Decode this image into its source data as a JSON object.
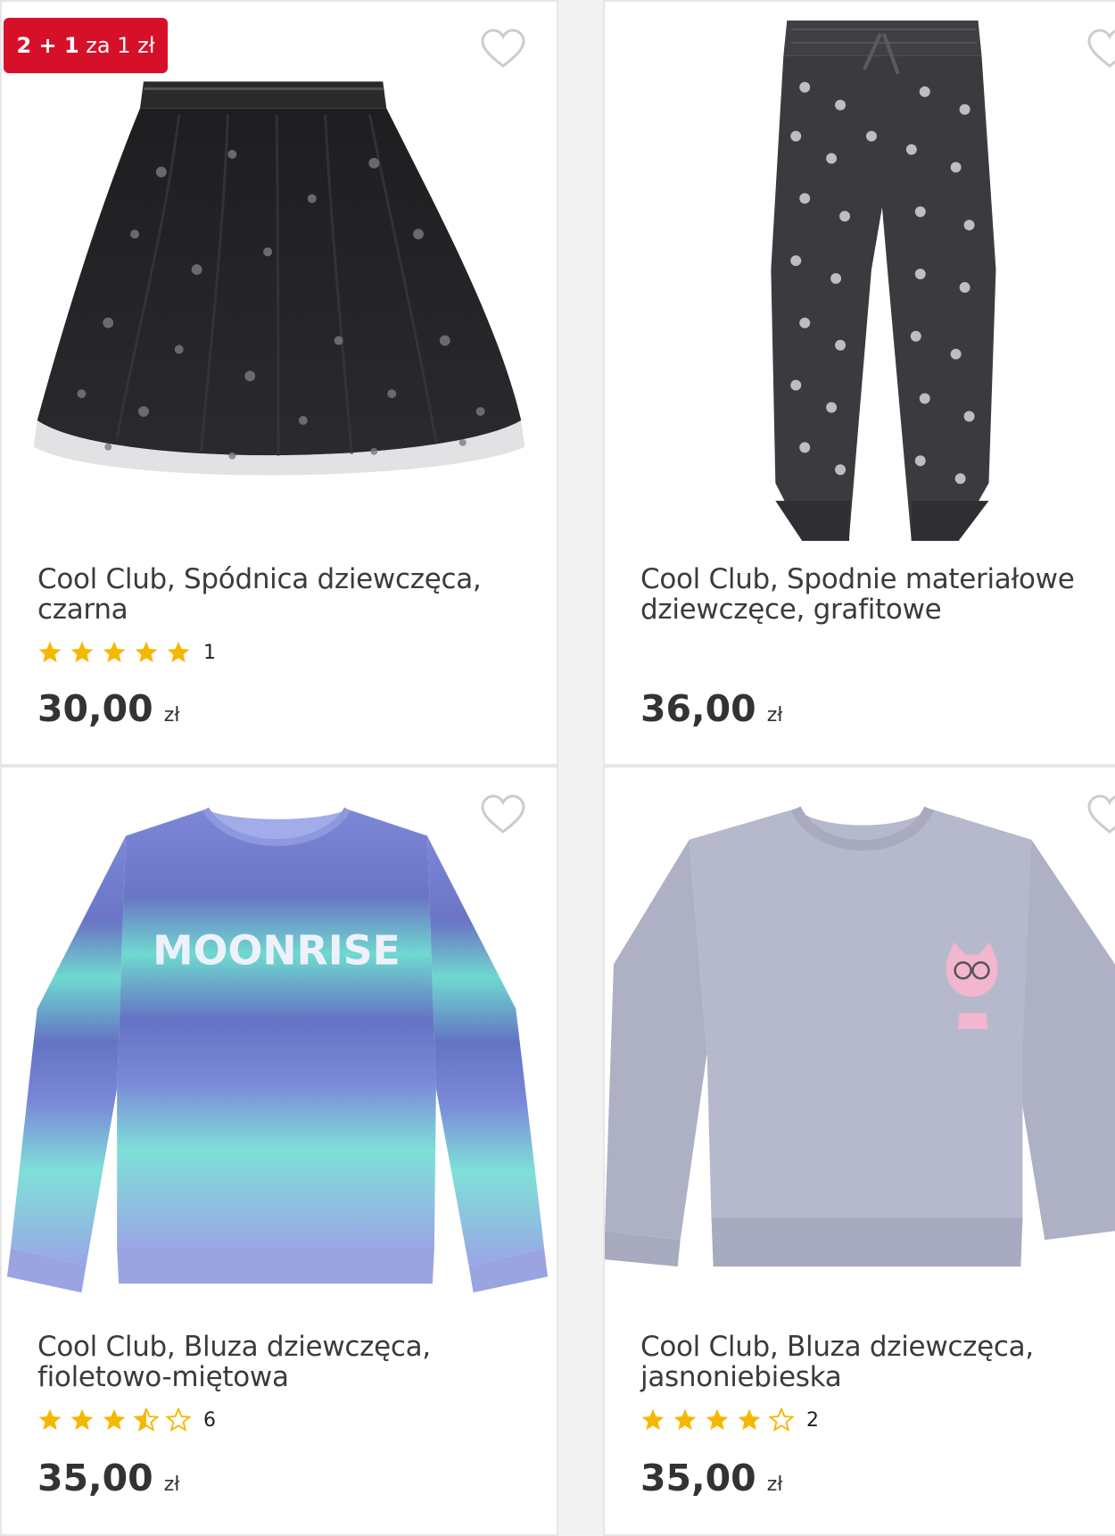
{
  "products": [
    {
      "badge": {
        "strong": "2 + 1",
        "rest": "za 1 zł"
      },
      "title_line1": "Cool Club, Spódnica dziewczęca,",
      "title_line2": "czarna",
      "rating": 5,
      "rating_count": "1",
      "price": "30,00",
      "currency": "zł",
      "image_icon": "tulle-skirt-image"
    },
    {
      "title_line1": "Cool Club, Spodnie materiałowe",
      "title_line2": "dziewczęce, grafitowe",
      "price": "36,00",
      "currency": "zł",
      "image_icon": "polka-dot-pants-image"
    },
    {
      "title_line1": "Cool Club, Bluza dziewczęca,",
      "title_line2": "fioletowo-miętowa",
      "rating": 3.5,
      "rating_count": "6",
      "price": "35,00",
      "currency": "zł",
      "print_text": "MOONRISE",
      "image_icon": "gradient-sweatshirt-image"
    },
    {
      "title_line1": "Cool Club, Bluza dziewczęca,",
      "title_line2": "jasnoniebieska",
      "rating": 4,
      "rating_count": "2",
      "price": "35,00",
      "currency": "zł",
      "image_icon": "light-blue-sweatshirt-image"
    }
  ],
  "colors": {
    "badge": "#d7102a",
    "star": "#f5b800",
    "price": "#333333",
    "border": "#e6e6e6"
  },
  "icons": [
    "heart-outline-icon",
    "star-icon"
  ]
}
